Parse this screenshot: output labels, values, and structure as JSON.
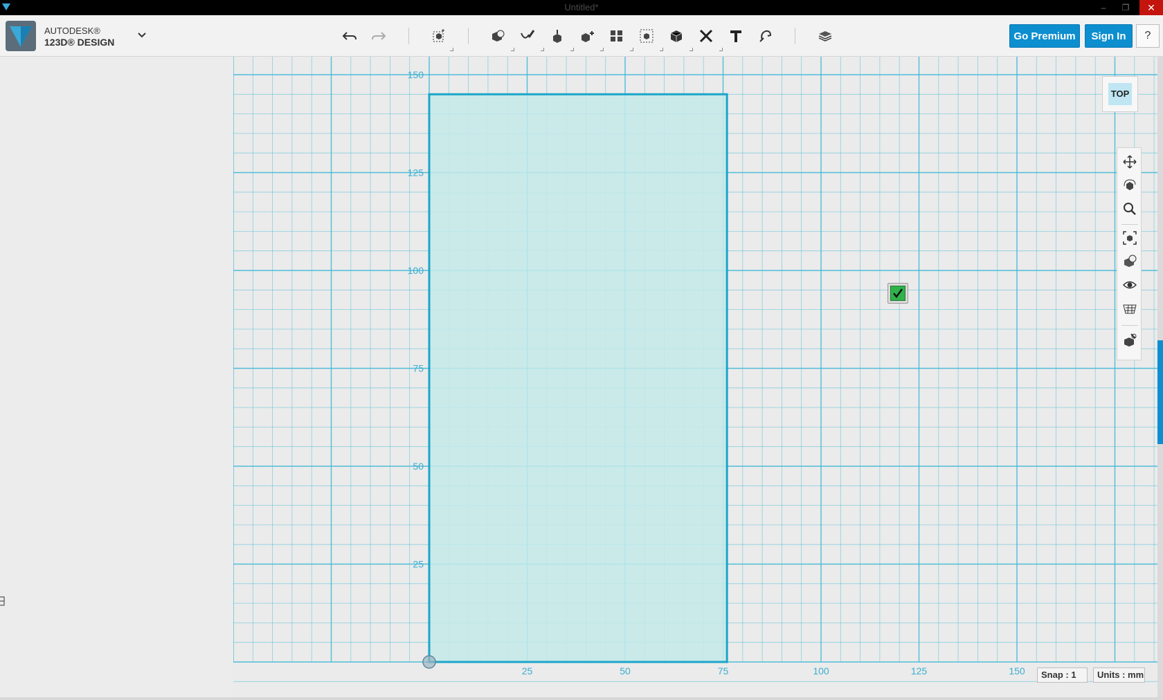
{
  "window": {
    "title": "Untitled*",
    "minimize": "–",
    "restore": "❐",
    "close": "✕"
  },
  "brand": {
    "line1": "AUTODESK®",
    "line2": "123D® DESIGN"
  },
  "toolbar": {
    "tools": [
      {
        "name": "undo-icon"
      },
      {
        "name": "redo-icon"
      },
      {
        "name": "transform-icon"
      },
      {
        "name": "primitives-icon"
      },
      {
        "name": "sketch-icon"
      },
      {
        "name": "construct-icon"
      },
      {
        "name": "modify-icon"
      },
      {
        "name": "pattern-icon"
      },
      {
        "name": "grouping-icon"
      },
      {
        "name": "combine-icon"
      },
      {
        "name": "measure-icon"
      },
      {
        "name": "text-icon"
      },
      {
        "name": "snap-icon"
      },
      {
        "name": "materials-icon"
      }
    ],
    "go_premium": "Go Premium",
    "sign_in": "Sign In",
    "help": "?"
  },
  "view_cube": {
    "face": "TOP"
  },
  "nav_bar": {
    "items": [
      "pan-icon",
      "orbit-icon",
      "zoom-icon",
      "fit-icon",
      "views-icon",
      "visibility-icon",
      "grid-icon",
      "material-view-icon"
    ]
  },
  "grid": {
    "x_labels": [
      "25",
      "50",
      "75",
      "100",
      "125",
      "150"
    ],
    "y_labels": [
      "150",
      "125",
      "100",
      "75",
      "50",
      "25"
    ]
  },
  "sketch": {
    "width_mm": 76,
    "height_mm": 145
  },
  "status": {
    "snap": "Snap : 1",
    "units": "Units : mm"
  },
  "colors": {
    "accent": "#0d8ecf",
    "grid": "#3db8d6",
    "sketch_fill": "#c4eaea",
    "sketch_stroke": "#1ba5c8"
  }
}
